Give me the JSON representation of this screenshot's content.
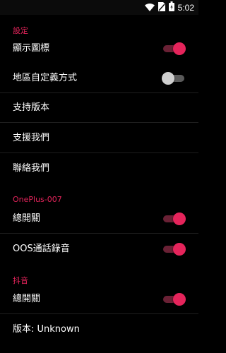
{
  "status_bar": {
    "time": "5:02",
    "icons": [
      "wifi-icon",
      "no-sim-icon",
      "battery-icon"
    ]
  },
  "colors": {
    "accent": "#e5245b",
    "background": "#000000",
    "divider": "#1e1e1e"
  },
  "sections": {
    "settings": {
      "title": "設定",
      "items": [
        {
          "label": "顯示圖標",
          "toggle": true
        },
        {
          "label": "地區自定義方式",
          "toggle": false
        },
        {
          "label": "支持版本"
        },
        {
          "label": "支援我們"
        },
        {
          "label": "聯絡我們"
        }
      ]
    },
    "oneplus": {
      "title": "OnePlus-007",
      "items": [
        {
          "label": "總開關",
          "toggle": true
        },
        {
          "label": "OOS通話錄音",
          "toggle": true
        }
      ]
    },
    "douyin": {
      "title": "抖音",
      "items": [
        {
          "label": "總開關",
          "toggle": true
        },
        {
          "label": "版本: Unknown"
        }
      ]
    }
  }
}
